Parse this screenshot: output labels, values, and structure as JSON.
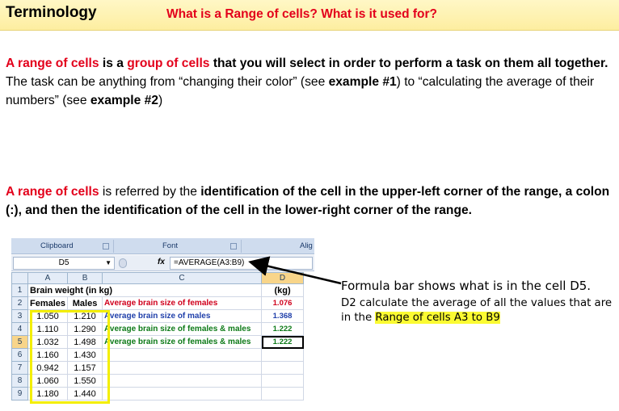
{
  "header": {
    "title": "Terminology",
    "subtitle": "What is a Range of cells? What is it used for?"
  },
  "para1": {
    "s1": "A range of cells",
    "s2": " is a ",
    "s3": "group of cells",
    "s4": " that you will select in order to perform a task on them all together.",
    "s5": "The task can be anything from  “changing their color” (see ",
    "s6": "example #1",
    "s7": ") to “calculating  the average of their numbers” (see ",
    "s8": "example #2",
    "s9": ")"
  },
  "para2": {
    "s1": "A range of cells",
    "s2": " is referred by the ",
    "s3": "identification of the cell in the upper-left corner of the range, a colon (:), and then the identification of the cell in the lower-right corner of the range."
  },
  "excel": {
    "ribbon": {
      "clipboard": "Clipboard",
      "font": "Font",
      "align": "Alig"
    },
    "namebox": "D5",
    "fx": "fx",
    "formula": "=AVERAGE(A3:B9)",
    "columns": [
      "",
      "A",
      "B",
      "C",
      "D"
    ],
    "rows": [
      {
        "n": "1",
        "a": "Brain weight (in kg)",
        "b": "",
        "c": "",
        "d": "(kg)"
      },
      {
        "n": "2",
        "a": "Females",
        "b": "Males",
        "c": "Average brain size of females",
        "d": "1.076"
      },
      {
        "n": "3",
        "a": "1.050",
        "b": "1.210",
        "c": "Average brain size of males",
        "d": "1.368"
      },
      {
        "n": "4",
        "a": "1.110",
        "b": "1.290",
        "c": "Average brain size of females & males",
        "d": "1.222"
      },
      {
        "n": "5",
        "a": "1.032",
        "b": "1.498",
        "c": "Average brain size of females & males",
        "d": "1.222"
      },
      {
        "n": "6",
        "a": "1.160",
        "b": "1.430",
        "c": "",
        "d": ""
      },
      {
        "n": "7",
        "a": "0.942",
        "b": "1.157",
        "c": "",
        "d": ""
      },
      {
        "n": "8",
        "a": "1.060",
        "b": "1.550",
        "c": "",
        "d": ""
      },
      {
        "n": "9",
        "a": "1.180",
        "b": "1.440",
        "c": "",
        "d": ""
      }
    ]
  },
  "note": {
    "line1": "Formula bar shows what is in the cell D5.",
    "line2": "D2 calculate the average of all the values that are in the ",
    "highlight": "Range of cells A3 to B9"
  },
  "colors": {
    "red": "#e3001b",
    "highlight": "#fbfb32",
    "header_bg": "#fdeea0"
  }
}
